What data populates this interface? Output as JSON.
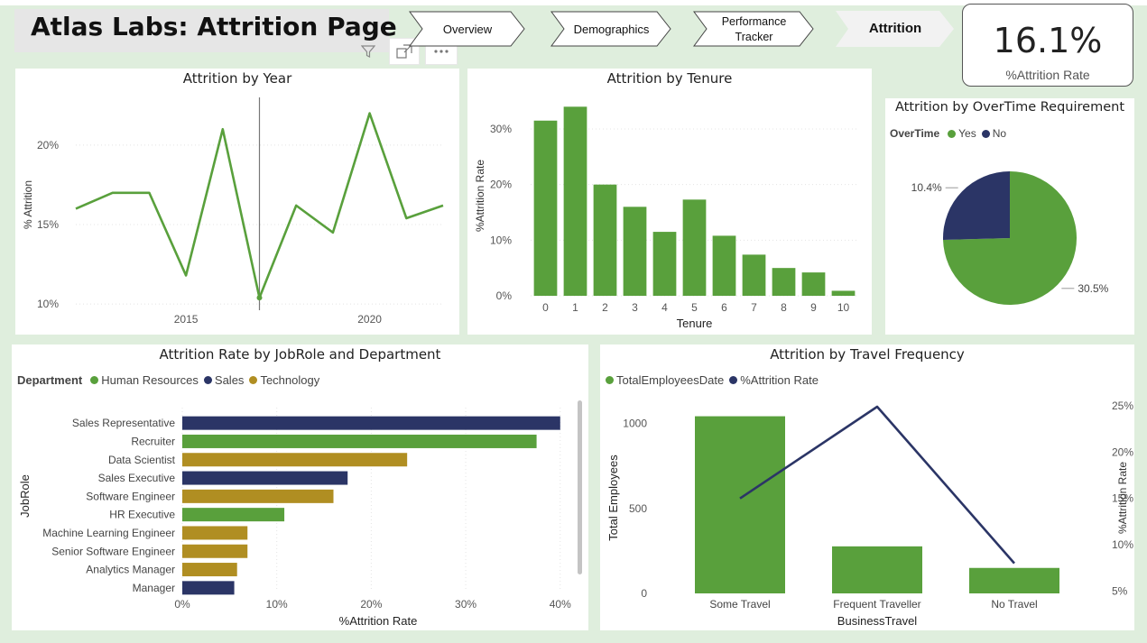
{
  "header": {
    "title": "Atlas Labs: Attrition Page",
    "nav": [
      {
        "label": "Overview",
        "active": false
      },
      {
        "label": "Demographics",
        "active": false
      },
      {
        "label": "Performance Tracker",
        "active": false
      },
      {
        "label": "Attrition",
        "active": true
      }
    ],
    "tool_icons": [
      "filter-icon",
      "focus-mode-icon",
      "more-options-icon"
    ]
  },
  "kpi": {
    "value": "16.1%",
    "label": "%Attrition Rate"
  },
  "colors": {
    "green": "#59a03c",
    "navy": "#2b3566",
    "gold": "#b08e22",
    "background": "#dfeedd"
  },
  "charts": {
    "year": {
      "title": "Attrition by Year"
    },
    "tenure": {
      "title": "Attrition by Tenure"
    },
    "overtime": {
      "title": "Attrition by OverTime Requirement",
      "legend_title": "OverTime"
    },
    "jobrole": {
      "title": "Attrition Rate by JobRole and Department",
      "legend_title": "Department"
    },
    "travel": {
      "title": "Attrition by Travel Frequency"
    }
  },
  "chart_data": [
    {
      "id": "year",
      "type": "line",
      "title": "Attrition by Year",
      "xlabel": "",
      "ylabel": "% Attrition",
      "x": [
        2012,
        2013,
        2014,
        2015,
        2016,
        2017,
        2018,
        2019,
        2020,
        2021,
        2022
      ],
      "xticks": [
        2015,
        2020
      ],
      "yticks": [
        "10%",
        "15%",
        "20%"
      ],
      "ylim": [
        9.5,
        23.0
      ],
      "series": [
        {
          "values": [
            16.0,
            17.0,
            17.0,
            11.8,
            21.0,
            10.4,
            16.2,
            14.5,
            22.0,
            15.4,
            16.2
          ],
          "color": "#59a03c"
        }
      ],
      "annotations": [
        {
          "type": "vertical-line",
          "x": 2017
        }
      ],
      "grid": true
    },
    {
      "id": "tenure",
      "type": "bar",
      "title": "Attrition by Tenure",
      "xlabel": "Tenure",
      "ylabel": "%Attrition Rate",
      "categories": [
        "0",
        "1",
        "2",
        "3",
        "4",
        "5",
        "6",
        "7",
        "8",
        "9",
        "10"
      ],
      "values": [
        31.5,
        34.0,
        20.0,
        16.0,
        11.5,
        17.3,
        10.8,
        7.4,
        5.0,
        4.2,
        0.9
      ],
      "yticks": [
        "0%",
        "10%",
        "20%",
        "30%"
      ],
      "ylim": [
        0,
        36
      ],
      "color": "#59a03c",
      "grid": true
    },
    {
      "id": "overtime",
      "type": "pie",
      "title": "Attrition by OverTime Requirement",
      "legend": [
        "Yes",
        "No"
      ],
      "slices": [
        {
          "label": "Yes",
          "value": 30.5,
          "display": "30.5%",
          "color": "#59a03c"
        },
        {
          "label": "No",
          "value": 10.4,
          "display": "10.4%",
          "color": "#2b3566"
        }
      ],
      "legend_placement": "top-left"
    },
    {
      "id": "jobrole",
      "type": "bar",
      "orientation": "horizontal",
      "title": "Attrition Rate by JobRole and Department",
      "xlabel": "%Attrition Rate",
      "ylabel": "JobRole",
      "legend_title": "Department",
      "legend": [
        {
          "name": "Human Resources",
          "color": "#59a03c"
        },
        {
          "name": "Sales",
          "color": "#2b3566"
        },
        {
          "name": "Technology",
          "color": "#b08e22"
        }
      ],
      "categories": [
        "Sales Representative",
        "Recruiter",
        "Data Scientist",
        "Sales Executive",
        "Software Engineer",
        "HR Executive",
        "Machine Learning Engineer",
        "Senior Software Engineer",
        "Analytics Manager",
        "Manager"
      ],
      "values": [
        40.0,
        37.5,
        23.8,
        17.5,
        16.0,
        10.8,
        6.9,
        6.9,
        5.8,
        5.5
      ],
      "departments": [
        "Sales",
        "Human Resources",
        "Technology",
        "Sales",
        "Technology",
        "Human Resources",
        "Technology",
        "Technology",
        "Technology",
        "Sales"
      ],
      "xticks": [
        "0%",
        "10%",
        "20%",
        "30%",
        "40%"
      ],
      "xlim": [
        0,
        40.5
      ]
    },
    {
      "id": "travel",
      "type": "bar",
      "title": "Attrition by Travel Frequency",
      "xlabel": "BusinessTravel",
      "ylabel": "Total Employees",
      "y2label": "%Attrition Rate",
      "categories": [
        "Some Travel",
        "Frequent Traveller",
        "No Travel"
      ],
      "legend": [
        {
          "name": "TotalEmployeesDate",
          "color": "#59a03c"
        },
        {
          "name": "%Attrition Rate",
          "color": "#2b3566"
        }
      ],
      "series": [
        {
          "name": "TotalEmployeesDate",
          "type": "bar",
          "values": [
            1043,
            277,
            150
          ],
          "color": "#59a03c"
        },
        {
          "name": "%Attrition Rate",
          "type": "line",
          "axis": "right",
          "values": [
            15.0,
            24.9,
            8.0
          ],
          "color": "#2b3566"
        }
      ],
      "yticks": [
        "0",
        "500",
        "1000"
      ],
      "ylim": [
        0,
        1200
      ],
      "y2ticks": [
        "5%",
        "10%",
        "15%",
        "20%",
        "25%"
      ],
      "y2lim": [
        4.75,
        26.75
      ]
    }
  ]
}
